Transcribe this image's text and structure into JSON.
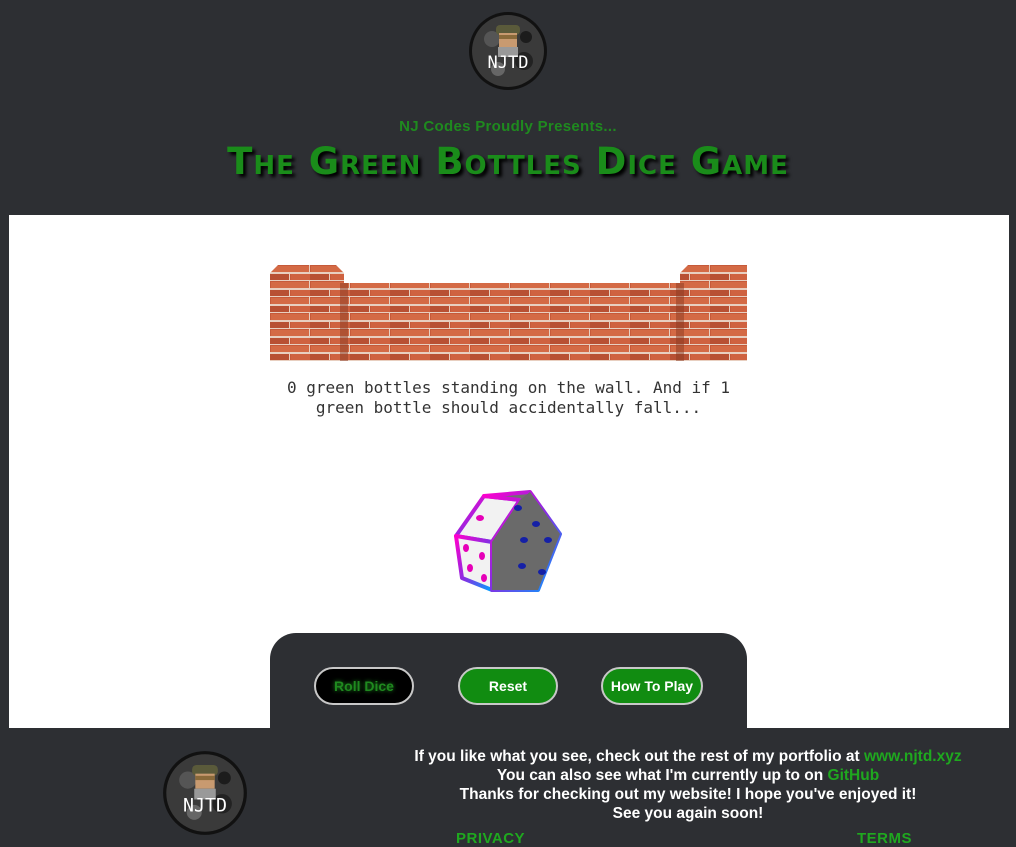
{
  "header": {
    "logo_text": "NJTD",
    "presents": "NJ Codes Proudly Presents...",
    "title": "The Green Bottles Dice Game"
  },
  "game": {
    "verse": "0 green bottles standing on the wall. And if 1 green bottle should accidentally fall..."
  },
  "controls": {
    "roll_label": "Roll Dice",
    "reset_label": "Reset",
    "how_label": "How To Play"
  },
  "footer": {
    "logo_text": "NJTD",
    "line1_prefix": "If you like what you see, check out the rest of my portfolio at ",
    "line1_link": "www.njtd.xyz",
    "line2_prefix": "You can also see what I'm currently up to on ",
    "line2_link": "GitHub",
    "line3": "Thanks for checking out my website! I hope you've enjoyed it!",
    "line4": "See you again soon!",
    "privacy": "PRIVACY",
    "terms": "TERMS"
  },
  "colors": {
    "background": "#2d2f33",
    "accent_green": "#1a8c1a",
    "panel": "#ffffff"
  }
}
